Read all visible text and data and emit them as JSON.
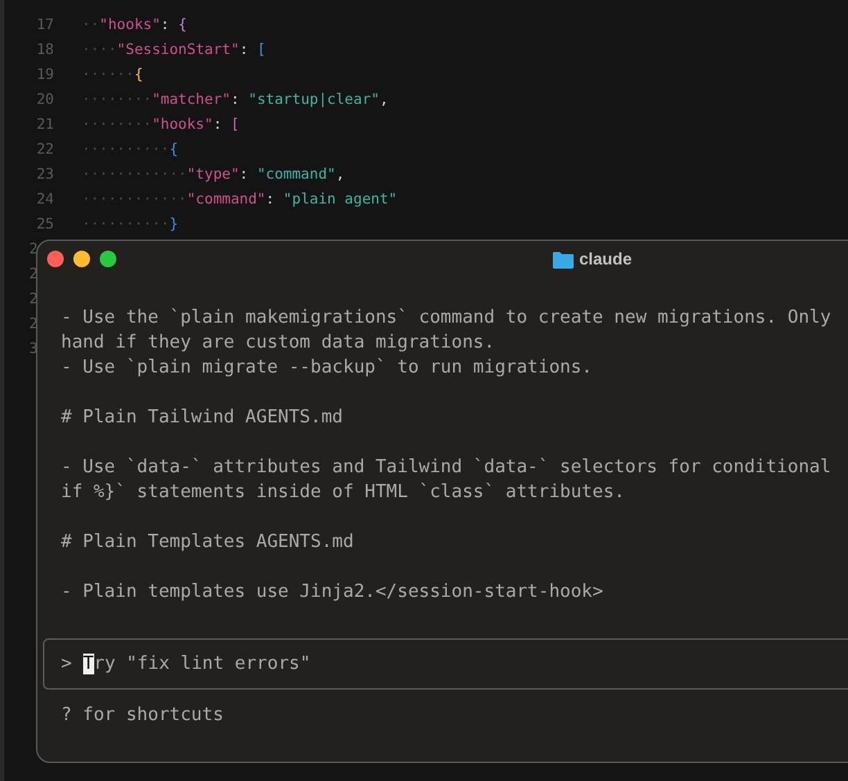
{
  "editor": {
    "lines": [
      {
        "number": "17",
        "indent": "··",
        "tokens": [
          {
            "kind": "key",
            "text": "\"hooks\""
          },
          {
            "kind": "punct",
            "text": ": "
          },
          {
            "kind": "bracket",
            "text": "{",
            "color": "#c678dd"
          }
        ]
      },
      {
        "number": "18",
        "indent": "····",
        "tokens": [
          {
            "kind": "key",
            "text": "\"SessionStart\""
          },
          {
            "kind": "punct",
            "text": ": "
          },
          {
            "kind": "bracket",
            "text": "[",
            "color": "#3b8eea"
          }
        ]
      },
      {
        "number": "19",
        "indent": "······",
        "tokens": [
          {
            "kind": "bracket",
            "text": "{",
            "color": "#f1c232"
          }
        ]
      },
      {
        "number": "20",
        "indent": "········",
        "tokens": [
          {
            "kind": "key",
            "text": "\"matcher\""
          },
          {
            "kind": "punct",
            "text": ": "
          },
          {
            "kind": "string",
            "text": "\"startup|clear\""
          },
          {
            "kind": "punct",
            "text": ","
          }
        ]
      },
      {
        "number": "21",
        "indent": "········",
        "tokens": [
          {
            "kind": "key",
            "text": "\"hooks\""
          },
          {
            "kind": "punct",
            "text": ": "
          },
          {
            "kind": "bracket",
            "text": "[",
            "color": "#d55fb8"
          }
        ]
      },
      {
        "number": "22",
        "indent": "··········",
        "tokens": [
          {
            "kind": "bracket",
            "text": "{",
            "color": "#3b8eea"
          }
        ]
      },
      {
        "number": "23",
        "indent": "············",
        "tokens": [
          {
            "kind": "key",
            "text": "\"type\""
          },
          {
            "kind": "punct",
            "text": ": "
          },
          {
            "kind": "string",
            "text": "\"command\""
          },
          {
            "kind": "punct",
            "text": ","
          }
        ]
      },
      {
        "number": "24",
        "indent": "············",
        "tokens": [
          {
            "kind": "key",
            "text": "\"command\""
          },
          {
            "kind": "punct",
            "text": ": "
          },
          {
            "kind": "string",
            "text": "\"plain agent\""
          }
        ]
      },
      {
        "number": "25",
        "indent": "··········",
        "tokens": [
          {
            "kind": "bracket",
            "text": "}",
            "color": "#3b8eea"
          }
        ]
      }
    ],
    "hidden_line_numbers": [
      "2",
      "2",
      "2",
      "2",
      "3"
    ]
  },
  "terminal": {
    "title": "claude",
    "output": [
      [
        "- Use the `plain makemigrations` command to create new migrations. Only",
        "hand if they are custom data migrations.",
        "- Use `plain migrate --backup` to run migrations."
      ],
      [
        "# Plain Tailwind AGENTS.md"
      ],
      [
        "- Use `data-` attributes and Tailwind `data-` selectors for conditional",
        "if %}` statements inside of HTML `class` attributes."
      ],
      [
        "# Plain Templates AGENTS.md"
      ],
      [
        "- Plain templates use Jinja2.</session-start-hook>"
      ]
    ],
    "prompt": {
      "symbol": ">",
      "placeholder": "Try \"fix lint errors\"",
      "cursor": true
    },
    "hint": "? for shortcuts"
  }
}
